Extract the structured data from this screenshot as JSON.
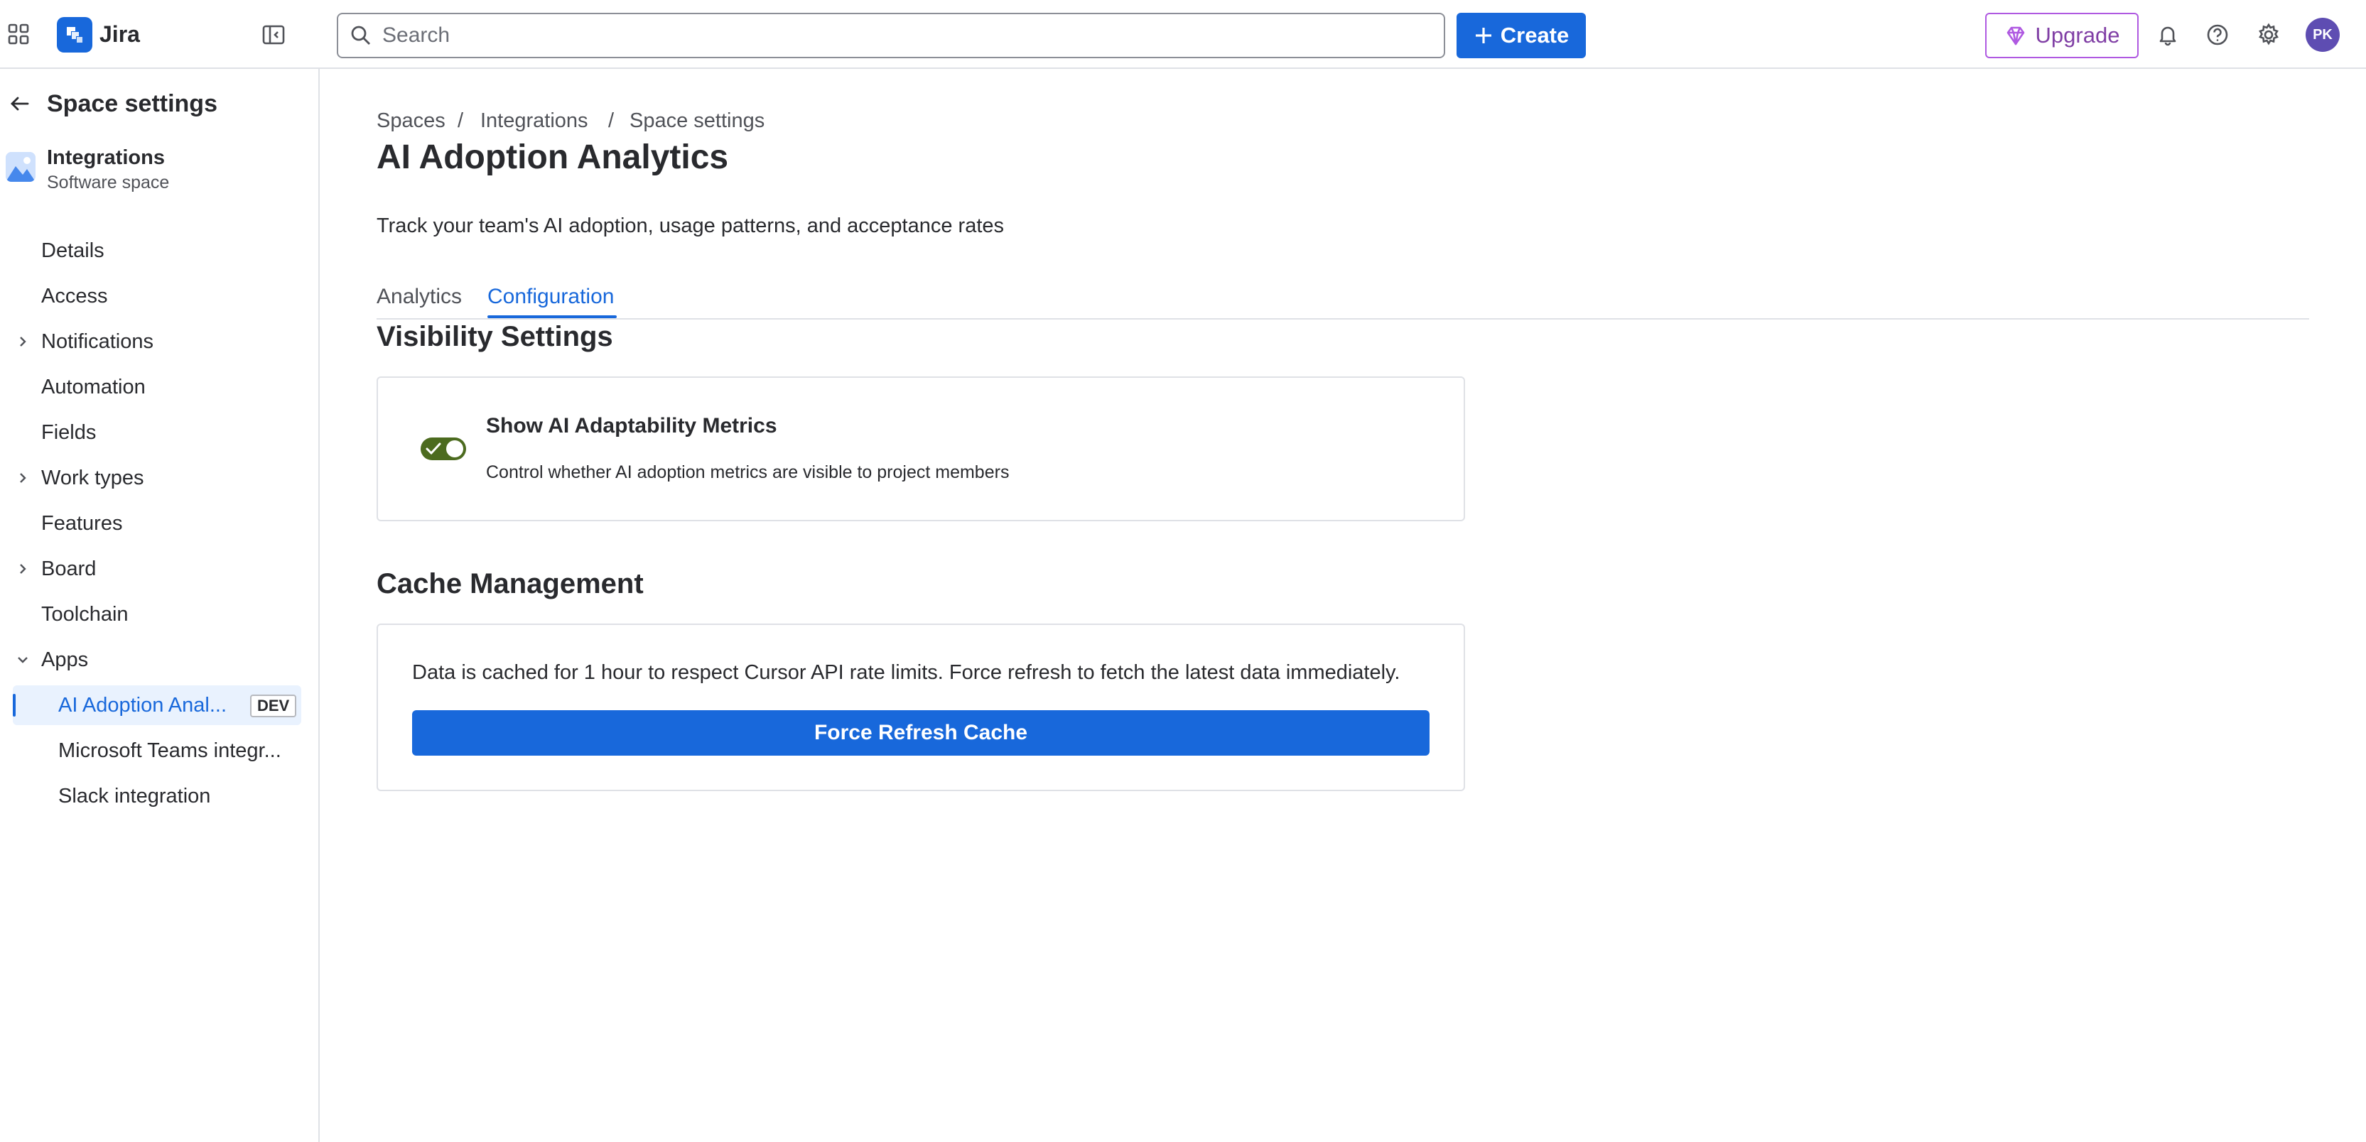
{
  "topbar": {
    "product_name": "Jira",
    "search_placeholder": "Search",
    "create_label": "Create",
    "upgrade_label": "Upgrade",
    "avatar_initials": "PK",
    "accent_color": "#1868db",
    "upgrade_color": "#af59e1",
    "icons": [
      "app-switcher-icon",
      "jira-logo-icon",
      "sidebar-toggle-icon",
      "search-icon",
      "plus-icon",
      "gem-icon",
      "bell-icon",
      "help-icon",
      "gear-icon"
    ]
  },
  "sidebar": {
    "title": "Space settings",
    "space": {
      "name": "Integrations",
      "type": "Software space"
    },
    "items": [
      {
        "label": "Details",
        "expandable": false
      },
      {
        "label": "Access",
        "expandable": false
      },
      {
        "label": "Notifications",
        "expandable": true
      },
      {
        "label": "Automation",
        "expandable": false
      },
      {
        "label": "Fields",
        "expandable": false
      },
      {
        "label": "Work types",
        "expandable": true
      },
      {
        "label": "Features",
        "expandable": false
      },
      {
        "label": "Board",
        "expandable": true
      },
      {
        "label": "Toolchain",
        "expandable": false
      },
      {
        "label": "Apps",
        "expandable": true,
        "expanded": true
      }
    ],
    "apps": [
      {
        "label": "AI Adoption Anal...",
        "badge": "DEV",
        "selected": true
      },
      {
        "label": "Microsoft Teams integr..."
      },
      {
        "label": "Slack integration"
      }
    ]
  },
  "main": {
    "breadcrumbs": [
      "Spaces",
      "Integrations",
      "Space settings"
    ],
    "title": "AI Adoption Analytics",
    "description": "Track your team's AI adoption, usage patterns, and acceptance rates",
    "tabs": [
      {
        "label": "Analytics",
        "active": false
      },
      {
        "label": "Configuration",
        "active": true
      }
    ],
    "visibility": {
      "section_title": "Visibility Settings",
      "toggle_label": "Show AI Adaptability Metrics",
      "toggle_description": "Control whether AI adoption metrics are visible to project members",
      "toggle_on": true,
      "toggle_color": "#4c6b1f"
    },
    "cache": {
      "section_title": "Cache Management",
      "description": "Data is cached for 1 hour to respect Cursor API rate limits. Force refresh to fetch the latest data immediately.",
      "button_label": "Force Refresh Cache"
    }
  }
}
